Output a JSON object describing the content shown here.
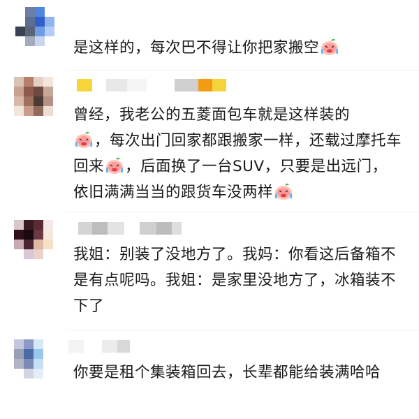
{
  "comments": [
    {
      "id": "c1",
      "text_parts": [
        "是这样的，每次巴不得让你把家搬空"
      ],
      "emoji": "crying-laugh-icon"
    },
    {
      "id": "c2",
      "text_parts": [
        "曾经，我老公的五菱面包车就是这样装的",
        "，每次出门回家都跟搬家一样，还载过摩托车回来",
        "，后面换了一台SUV，只要是出远门，依旧满满当当的跟货车没两样"
      ],
      "emoji": "crying-laugh-icon"
    },
    {
      "id": "c3",
      "text_parts": [
        "我姐：别装了没地方了。我妈：你看这后备箱不是有点呢吗。我姐：是家里没地方了，冰箱装不下了"
      ]
    },
    {
      "id": "c4",
      "text_parts": [
        "你要是租个集装箱回去，长辈都能给装满哈哈"
      ]
    }
  ],
  "colors": {
    "text": "#1a1a1a",
    "emoji_face": "#ff9b9b",
    "emoji_tear": "#5fb0ff",
    "emoji_leaf": "#4caf50"
  }
}
